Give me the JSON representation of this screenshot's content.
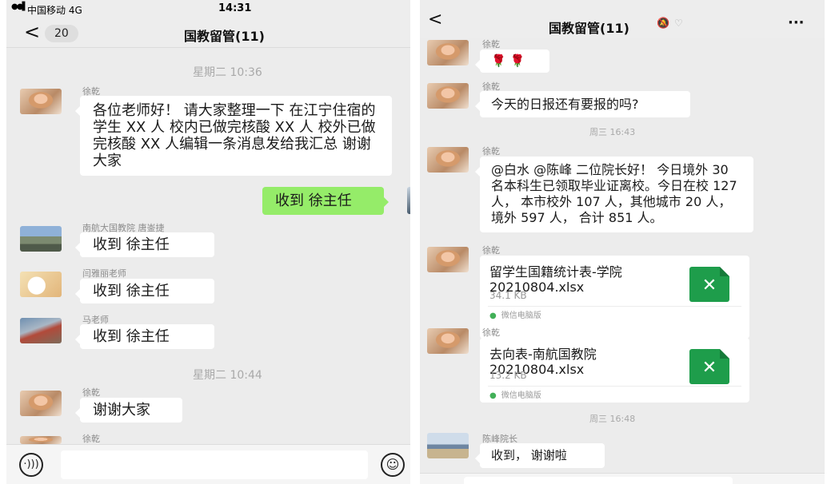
{
  "left": {
    "status": {
      "signal_bars": "●●▌",
      "carrier": "中国移动 4G",
      "time": "14:31"
    },
    "nav": {
      "back": "<",
      "unread": "20",
      "title": "国教留管(11)"
    },
    "messages": {
      "ts1": "星期二 10:36",
      "m1": {
        "name": "徐乾",
        "text": "各位老师好！ 请大家整理一下 在江宁住宿的学生 XX 人 校内已做完核酸 XX 人 校外已做完核酸 XX 人编辑一条消息发给我汇总 谢谢大家"
      },
      "m2": {
        "text": "收到 徐主任"
      },
      "m3": {
        "name": "南航大国教院 唐崟捷",
        "text": "收到 徐主任"
      },
      "m4": {
        "name": "闫雅丽老师",
        "text": "收到 徐主任"
      },
      "m5": {
        "name": "马老师",
        "text": "收到 徐主任"
      },
      "ts2": "星期二 10:44",
      "m6": {
        "name": "徐乾",
        "text": "谢谢大家"
      },
      "m7": {
        "name": "徐乾"
      }
    },
    "input": {
      "voice_icon": "voice-icon",
      "emoji_icon": "emoji-icon"
    }
  },
  "right": {
    "nav": {
      "back": "<",
      "title": "国教留管(11)",
      "mute_icon": "bell-muted-icon",
      "flag": "♡",
      "more": "···"
    },
    "messages": {
      "m1": {
        "name": "徐乾",
        "text": "🌹 🌹"
      },
      "m2": {
        "name": "徐乾",
        "text": "今天的日报还有要报的吗?"
      },
      "ts1": "周三 16:43",
      "m3": {
        "name": "徐乾",
        "text": "@白水 @陈峰  二位院长好！ 今日境外 30 名本科生已领取毕业证离校。今日在校 127 人， 本市校外 107 人，其他城市 20 人，境外 597 人， 合计 851 人。"
      },
      "m4": {
        "name": "徐乾",
        "file_title": "留学生国籍统计表-学院20210804.xlsx",
        "file_size": "34.1 KB",
        "source": "微信电脑版",
        "file_icon": "excel-icon"
      },
      "m5": {
        "name": "徐乾",
        "file_title": "去向表-南航国教院20210804.xlsx",
        "file_size": "13.2 KB",
        "source": "微信电脑版",
        "file_icon": "excel-icon"
      },
      "ts2": "周三 16:48",
      "m6": {
        "name": "陈峰院长",
        "text": "收到， 谢谢啦"
      }
    }
  }
}
